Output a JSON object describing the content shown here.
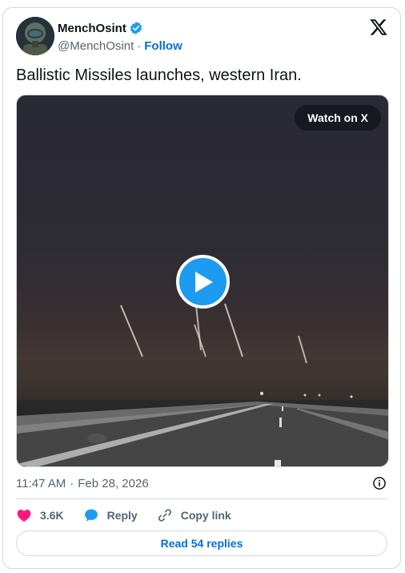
{
  "author": {
    "name": "MenchOsint",
    "handle": "@MenchOsint",
    "separator": "·",
    "follow_label": "Follow",
    "verified": true
  },
  "tweet": {
    "text": "Ballistic Missiles launches, western Iran."
  },
  "media": {
    "watch_label": "Watch on X",
    "play_icon": "play-icon"
  },
  "meta": {
    "time": "11:47 AM",
    "separator": "·",
    "date": "Feb 28, 2026"
  },
  "actions": {
    "likes": "3.6K",
    "reply_label": "Reply",
    "copy_label": "Copy link"
  },
  "read_replies_label": "Read 54 replies",
  "colors": {
    "accent": "#1d9bf0",
    "link": "#006fd6",
    "like": "#f91880",
    "muted": "#536471",
    "border": "#cfd9de"
  }
}
